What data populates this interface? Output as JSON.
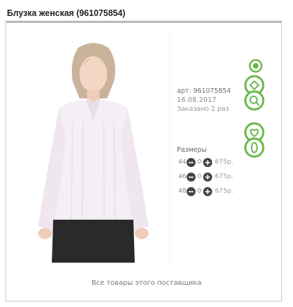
{
  "title": "Блузка женская (961075854)",
  "product": {
    "article": "арт: 961075854",
    "date": "16.08.2017",
    "ordered": "Заказано 2 раз"
  },
  "sizes": {
    "label": "Размеры",
    "rows": [
      {
        "size": "44",
        "qty": "0",
        "price": "675р."
      },
      {
        "size": "46",
        "qty": "0",
        "price": "675р."
      },
      {
        "size": "48",
        "qty": "0",
        "price": "675р."
      }
    ]
  },
  "footer": "Все товары этого поставщика",
  "colors": {
    "accent_green": "#6ab84a",
    "button_dark": "#444444"
  }
}
